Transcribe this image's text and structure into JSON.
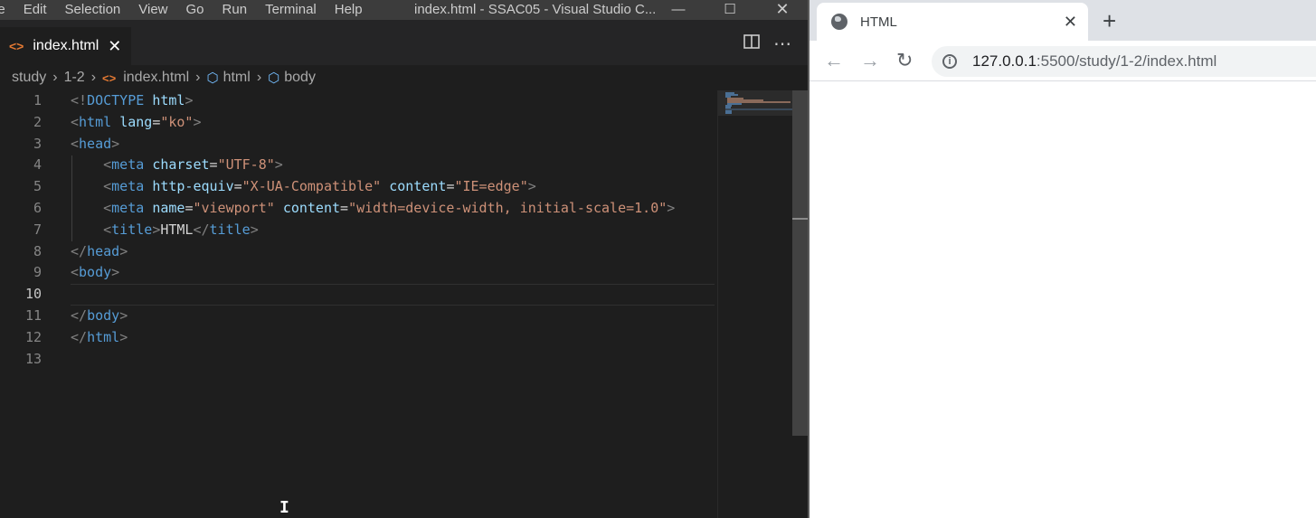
{
  "vscode": {
    "menu": [
      "le",
      "Edit",
      "Selection",
      "View",
      "Go",
      "Run",
      "Terminal",
      "Help"
    ],
    "window_title": "index.html - SSAC05 - Visual Studio C...",
    "window_controls": {
      "minimize": "—",
      "maximize": "☐",
      "close": "✕"
    },
    "tab": {
      "label": "index.html",
      "icon": "html-code-icon",
      "close": "✕"
    },
    "editor_actions": {
      "split": "split-editor-icon",
      "more": "⋯"
    },
    "breadcrumb": [
      "study",
      "1-2",
      "index.html",
      "html",
      "body"
    ],
    "line_numbers": [
      "1",
      "2",
      "3",
      "4",
      "5",
      "6",
      "7",
      "8",
      "9",
      "10",
      "11",
      "12",
      "13"
    ],
    "active_line": "10",
    "code": {
      "l1": [
        "<!",
        "DOCTYPE",
        " ",
        "html",
        ">"
      ],
      "l2": [
        "<",
        "html",
        " ",
        "lang",
        "=",
        "\"ko\"",
        ">"
      ],
      "l3": [
        "<",
        "head",
        ">"
      ],
      "l4": [
        "    <",
        "meta",
        " ",
        "charset",
        "=",
        "\"UTF-8\"",
        ">"
      ],
      "l5": [
        "    <",
        "meta",
        " ",
        "http-equiv",
        "=",
        "\"X-UA-Compatible\"",
        " ",
        "content",
        "=",
        "\"IE=edge\"",
        ">"
      ],
      "l6": [
        "    <",
        "meta",
        " ",
        "name",
        "=",
        "\"viewport\"",
        " ",
        "content",
        "=",
        "\"width=device-width, initial-scale=1.0\"",
        ">"
      ],
      "l7": [
        "    <",
        "title",
        ">",
        "HTML",
        "</",
        "title",
        ">"
      ],
      "l8": [
        "</",
        "head",
        ">"
      ],
      "l9": [
        "<",
        "body",
        ">"
      ],
      "l11": [
        "</",
        "body",
        ">"
      ],
      "l12": [
        "</",
        "html",
        ">"
      ]
    }
  },
  "browser": {
    "tab_title": "HTML",
    "tab_close": "✕",
    "new_tab": "+",
    "back": "←",
    "forward": "→",
    "reload": "↻",
    "url_host": "127.0.0.1",
    "url_path": ":5500/study/1-2/index.html",
    "info": "i"
  },
  "colors": {
    "editor_bg": "#1e1e1e",
    "tag": "#569cd6",
    "attr": "#9cdcfe",
    "string": "#ce9178",
    "punctuation": "#808080",
    "html_icon": "#e37933"
  }
}
